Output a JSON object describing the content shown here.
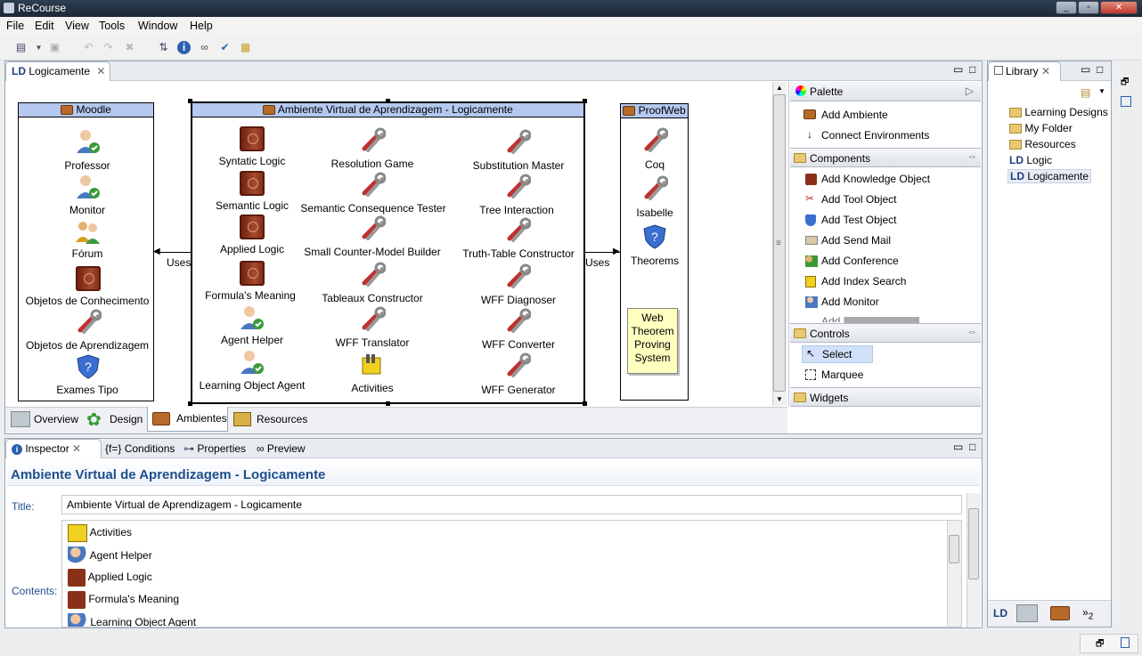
{
  "window": {
    "title": "ReCourse"
  },
  "menu": [
    "File",
    "Edit",
    "View",
    "Tools",
    "Window",
    "Help"
  ],
  "editor": {
    "tab": "Logicamente"
  },
  "moodle": {
    "title": "Moodle",
    "items": [
      "Professor",
      "Monitor",
      "Fórum",
      "Objetos de Conhecimento",
      "Objetos de Aprendizagem",
      "Exames Tipo"
    ]
  },
  "ava": {
    "title": "Ambiente Virtual de Aprendizagem -  Logicamente",
    "col1": [
      "Syntatic Logic",
      "Semantic Logic",
      "Applied Logic",
      "Formula's Meaning",
      "Agent Helper",
      "Learning Object Agent"
    ],
    "col2": [
      "Resolution Game",
      "Semantic Consequence Tester",
      "Small Counter-Model Builder",
      "Tableaux Constructor",
      "WFF Translator",
      "Activities"
    ],
    "col3": [
      "Substitution Master",
      "Tree Interaction",
      "Truth-Table Constructor",
      "WFF Diagnoser",
      "WFF Converter",
      "WFF Generator"
    ]
  },
  "proofweb": {
    "title": "ProofWeb",
    "items": [
      "Coq",
      "Isabelle",
      "Theorems"
    ],
    "note": "Web Theorem Proving System"
  },
  "uses": "Uses",
  "bottom_tabs": [
    "Overview",
    "Design",
    "Ambientes",
    "Resources"
  ],
  "palette": {
    "title": "Palette",
    "items": [
      "Add Ambiente",
      "Connect Environments"
    ],
    "components_label": "Components",
    "components": [
      "Add Knowledge Object",
      "Add Tool Object",
      "Add Test Object",
      "Add Send Mail",
      "Add Conference",
      "Add Index Search",
      "Add Monitor",
      "Add Note"
    ],
    "controls_label": "Controls",
    "controls": [
      "Select",
      "Marquee"
    ],
    "widgets_label": "Widgets"
  },
  "library": {
    "title": "Library",
    "items": [
      "Learning Designs",
      "My Folder",
      "Resources",
      "Logic",
      "Logicamente"
    ]
  },
  "inspector": {
    "tabs": [
      "Inspector",
      "Conditions",
      "Properties",
      "Preview"
    ],
    "heading": "Ambiente Virtual de Aprendizagem -  Logicamente",
    "title_label": "Title:",
    "title_value": "Ambiente Virtual de Aprendizagem -  Logicamente",
    "contents_label": "Contents:",
    "contents": [
      "Activities",
      "Agent Helper",
      "Applied Logic",
      "Formula's Meaning",
      "Learning Object Agent"
    ]
  },
  "colors": {
    "box_header": "#b4c8f0",
    "heading": "#1e4e8c",
    "note": "#ffffc0"
  }
}
